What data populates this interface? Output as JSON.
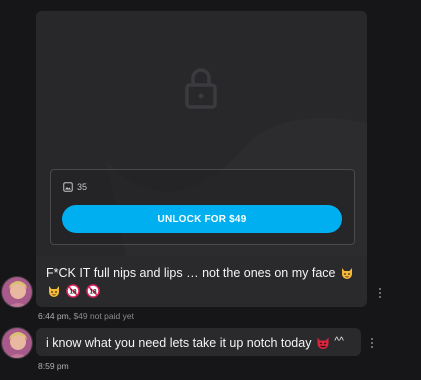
{
  "locked_post": {
    "media_count": "35",
    "unlock_label": "UNLOCK FOR $49"
  },
  "messages": [
    {
      "text": "F*CK IT full nips and lips … not the ones on my face",
      "emojis": [
        "cat-emoji",
        "cat-emoji",
        "18-emoji",
        "18-emoji"
      ],
      "time": "6:44 pm",
      "price_status": "$49 not paid yet"
    },
    {
      "text": "i know what you need lets take it up notch today",
      "trailing": "^^",
      "emojis": [
        "devil-emoji"
      ],
      "time": "8:59 pm"
    }
  ],
  "colors": {
    "accent": "#00aff0",
    "background": "#161618",
    "card": "#2a2a2d"
  }
}
